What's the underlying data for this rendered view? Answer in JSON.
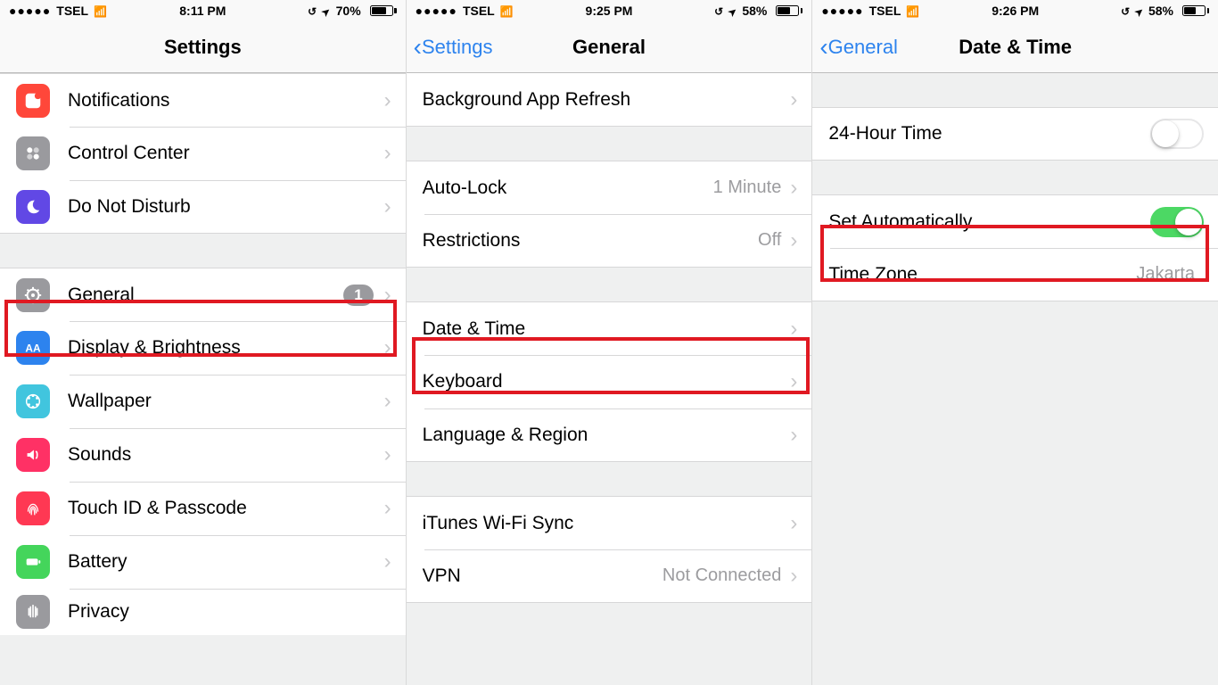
{
  "panes": [
    {
      "status": {
        "signal": "●●●●●",
        "carrier": "TSEL",
        "time": "8:11 PM",
        "battery": "70%"
      },
      "nav": {
        "title": "Settings",
        "back": null
      },
      "rows": [
        {
          "icon": "notifications-icon",
          "label": "Notifications"
        },
        {
          "icon": "control-center-icon",
          "label": "Control Center"
        },
        {
          "icon": "do-not-disturb-icon",
          "label": "Do Not Disturb"
        }
      ],
      "rows2": [
        {
          "icon": "general-icon",
          "label": "General",
          "badge": "1"
        },
        {
          "icon": "display-icon",
          "label": "Display & Brightness"
        },
        {
          "icon": "wallpaper-icon",
          "label": "Wallpaper"
        },
        {
          "icon": "sounds-icon",
          "label": "Sounds"
        },
        {
          "icon": "touchid-icon",
          "label": "Touch ID & Passcode"
        },
        {
          "icon": "battery-icon",
          "label": "Battery"
        },
        {
          "icon": "privacy-icon",
          "label": "Privacy"
        }
      ]
    },
    {
      "status": {
        "signal": "●●●●●",
        "carrier": "TSEL",
        "time": "9:25 PM",
        "battery": "58%"
      },
      "nav": {
        "title": "General",
        "back": "Settings"
      },
      "rows": [
        {
          "label": "Background App Refresh"
        }
      ],
      "rows2": [
        {
          "label": "Auto-Lock",
          "detail": "1 Minute"
        },
        {
          "label": "Restrictions",
          "detail": "Off"
        }
      ],
      "rows3": [
        {
          "label": "Date & Time"
        },
        {
          "label": "Keyboard"
        },
        {
          "label": "Language & Region"
        }
      ],
      "rows4": [
        {
          "label": "iTunes Wi-Fi Sync"
        },
        {
          "label": "VPN",
          "detail": "Not Connected"
        }
      ]
    },
    {
      "status": {
        "signal": "●●●●●",
        "carrier": "TSEL",
        "time": "9:26 PM",
        "battery": "58%"
      },
      "nav": {
        "title": "Date & Time",
        "back": "General"
      },
      "rows": [
        {
          "label": "24-Hour Time",
          "toggle": "off"
        }
      ],
      "rows2": [
        {
          "label": "Set Automatically",
          "toggle": "on"
        },
        {
          "label": "Time Zone",
          "detail": "Jakarta"
        }
      ]
    }
  ]
}
